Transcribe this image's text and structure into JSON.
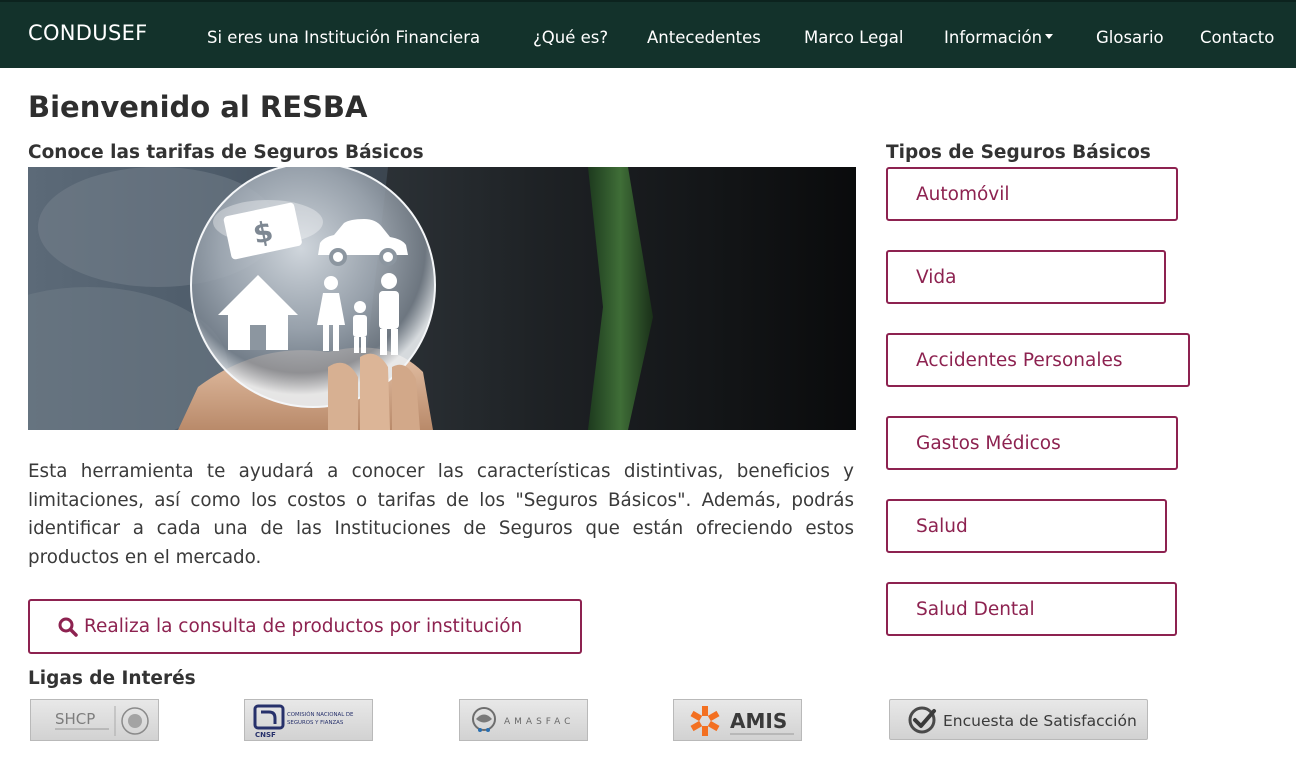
{
  "nav": {
    "brand": "CONDUSEF",
    "items": [
      {
        "label": "Si eres una Institución Financiera"
      },
      {
        "label": "¿Qué es?"
      },
      {
        "label": "Antecedentes"
      },
      {
        "label": "Marco Legal"
      },
      {
        "label": "Información",
        "dropdown": true
      },
      {
        "label": "Glosario"
      },
      {
        "label": "Contacto"
      }
    ]
  },
  "main": {
    "title": "Bienvenido al RESBA",
    "rates_heading": "Conoce las tarifas de Seguros Básicos",
    "intro": "Esta herramienta te ayudará a conocer las características distintivas, beneficios y limitaciones, así como los costos o tarifas de los \"Seguros Básicos\". Además, podrás identificar a cada una de las Instituciones de Seguros que están ofreciendo estos productos en el mercado.",
    "consult_button": "Realiza la consulta de productos por institución",
    "consult_icon": "search-icon"
  },
  "sidebar": {
    "heading": "Tipos de Seguros Básicos",
    "items": [
      {
        "label": "Automóvil"
      },
      {
        "label": "Vida"
      },
      {
        "label": "Accidentes Personales"
      },
      {
        "label": "Gastos Médicos"
      },
      {
        "label": "Salud"
      },
      {
        "label": "Salud Dental"
      }
    ]
  },
  "links": {
    "heading": "Ligas de Interés",
    "logos": [
      {
        "name": "SHCP"
      },
      {
        "name": "CNSF",
        "subtitle": "COMISIÓN NACIONAL DE SEGUROS Y FIANZAS"
      },
      {
        "name": "AMASFAC"
      },
      {
        "name": "AMIS"
      },
      {
        "name": "Encuesta de Satisfacción"
      }
    ]
  },
  "colors": {
    "navbar": "#13322b",
    "accent": "#8d2250",
    "text": "#2b2b2b"
  }
}
